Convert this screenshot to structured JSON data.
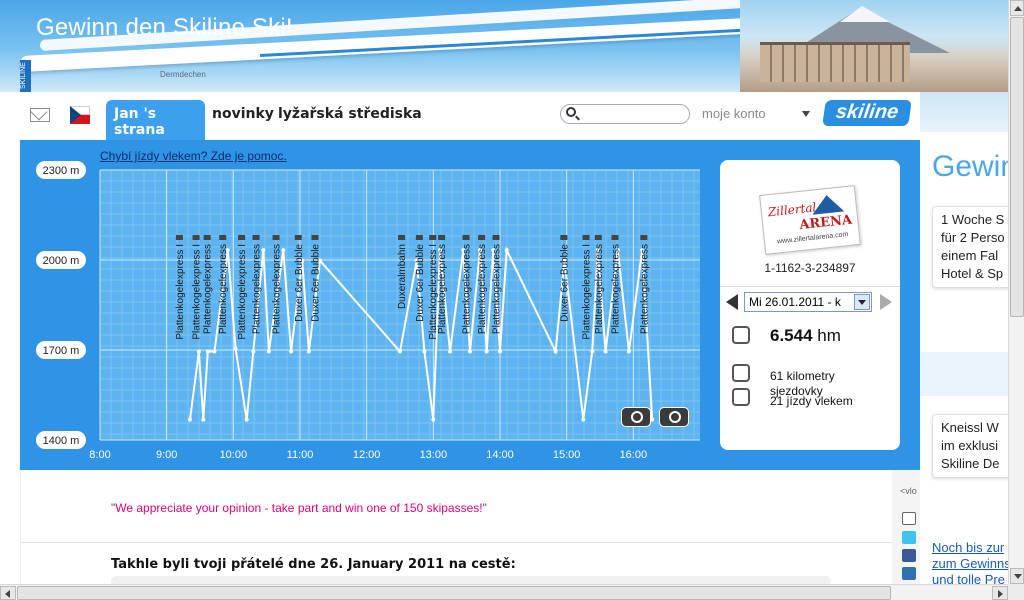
{
  "banner": {
    "title": "Gewinn den Skiline Ski!",
    "side_tab": "SKILINE",
    "sponsor": "Dermdechen"
  },
  "nav": {
    "tab_active": "Jan 's strana",
    "link_news": "novinky",
    "link_resorts": "lyžařská střediska",
    "search_placeholder": "",
    "account_label": "moje konto",
    "logo_text": "skiline"
  },
  "chart_panel": {
    "help_link": "Chybí jízdy vlekem? Zde je pomoc."
  },
  "info_card": {
    "resort_logo_line1": "Zillertal",
    "resort_logo_line2": "ARENA",
    "resort_logo_url": "www.zillertalarena.com",
    "ticket_id": "1-1162-3-234897",
    "date_value": "Mi 26.01.2011 - k",
    "stat_hm_value": "6.544",
    "stat_hm_unit": "hm",
    "stat_km_value": "61 kilometry",
    "stat_km_label": "sjezdovky",
    "stat_lifts": "21 jízdy vlekem"
  },
  "lower": {
    "promo_open": "\"",
    "promo_text": "We appreciate your opinion - take part and win one of 150 skipasses!",
    "promo_close": "\"",
    "friends_title": "Takhle byli tvoji přátelé dne 26. January 2011 na cestě:"
  },
  "social": {
    "more": "<vlo"
  },
  "right_panel": {
    "title": "Gewinn",
    "card1": [
      "1 Woche S",
      "für 2 Perso",
      "einem Fal",
      "Hotel & Sp"
    ],
    "card2": [
      "Kneissl W",
      "im exklusi",
      "Skiline De"
    ],
    "link": [
      "Noch bis zur",
      "zum Gewinns",
      "und tolle Pre"
    ]
  },
  "colors": {
    "chart_bg": "#2f93e6",
    "plot_bg": "#5db4f0",
    "line": "#ffffff",
    "accent": "#3da0ec",
    "promo": "#e0007a"
  },
  "chart_data": {
    "type": "line",
    "title": "",
    "xlabel": "",
    "ylabel": "",
    "x_ticks": [
      "8:00",
      "9:00",
      "10:00",
      "11:00",
      "12:00",
      "13:00",
      "14:00",
      "15:00",
      "16:00"
    ],
    "y_ticks": [
      "2300 m",
      "2000 m",
      "1700 m",
      "1400 m"
    ],
    "xlim": [
      "8:00",
      "17:00"
    ],
    "ylim": [
      1400,
      2300
    ],
    "series": [
      {
        "points": [
          [
            "9:21",
            1468
          ],
          [
            "9:29",
            1695
          ],
          [
            "9:33",
            1468
          ],
          [
            "9:37",
            1695
          ],
          [
            "9:43",
            1695
          ],
          [
            "9:55",
            2033
          ],
          [
            "10:02",
            1704
          ],
          [
            "10:12",
            1468
          ],
          [
            "10:18",
            1695
          ],
          [
            "10:27",
            2033
          ],
          [
            "10:32",
            1695
          ],
          [
            "10:45",
            2033
          ],
          [
            "10:52",
            1695
          ],
          [
            "11:02",
            1998
          ],
          [
            "11:08",
            1695
          ],
          [
            "11:18",
            1998
          ],
          [
            "12:30",
            1695
          ],
          [
            "12:45",
            1998
          ],
          [
            "12:52",
            1695
          ],
          [
            "13:00",
            1468
          ],
          [
            "13:06",
            2033
          ],
          [
            "13:15",
            1695
          ],
          [
            "13:27",
            2033
          ],
          [
            "13:33",
            1695
          ],
          [
            "13:42",
            2033
          ],
          [
            "13:48",
            1695
          ],
          [
            "13:54",
            2033
          ],
          [
            "14:00",
            1695
          ],
          [
            "14:06",
            2033
          ],
          [
            "14:50",
            1695
          ],
          [
            "14:58",
            1998
          ],
          [
            "15:15",
            1468
          ],
          [
            "15:23",
            1695
          ],
          [
            "15:28",
            2033
          ],
          [
            "15:35",
            1695
          ],
          [
            "15:46",
            2033
          ],
          [
            "15:56",
            1695
          ],
          [
            "16:08",
            2033
          ],
          [
            "16:17",
            1468
          ]
        ]
      }
    ],
    "lift_labels": [
      {
        "time": "9:11",
        "name": "Plattenkogelexpress I"
      },
      {
        "time": "9:26",
        "name": "Plattenkogelexpress I"
      },
      {
        "time": "9:36",
        "name": "Plattenkogelexpress"
      },
      {
        "time": "9:50",
        "name": "Plattenkogelexpress"
      },
      {
        "time": "10:07",
        "name": "Plattenkogelexpress I"
      },
      {
        "time": "10:20",
        "name": "Plattenkogelexpress"
      },
      {
        "time": "10:38",
        "name": "Plattenkogelexpress"
      },
      {
        "time": "10:58",
        "name": "Duxer 6er Bubble"
      },
      {
        "time": "11:13",
        "name": "Duxer 6er Bubble"
      },
      {
        "time": "12:31",
        "name": "Duxeralmbahn"
      },
      {
        "time": "12:47",
        "name": "Duxer 6er Bubble"
      },
      {
        "time": "12:59",
        "name": "Plattenkogelexpress I"
      },
      {
        "time": "13:07",
        "name": "Plattenkogelexpress"
      },
      {
        "time": "13:29",
        "name": "Plattenkogelexpress"
      },
      {
        "time": "13:43",
        "name": "Plattenkogelexpress"
      },
      {
        "time": "13:56",
        "name": "Plattenkogelexpress"
      },
      {
        "time": "14:57",
        "name": "Duxer 6er Bubble"
      },
      {
        "time": "15:17",
        "name": "Plattenkogelexpress I"
      },
      {
        "time": "15:28",
        "name": "Plattenkogelexpress"
      },
      {
        "time": "15:43",
        "name": "Plattenkogelexpress"
      },
      {
        "time": "16:09",
        "name": "Plattenkogelexpress"
      }
    ],
    "grid": true
  }
}
